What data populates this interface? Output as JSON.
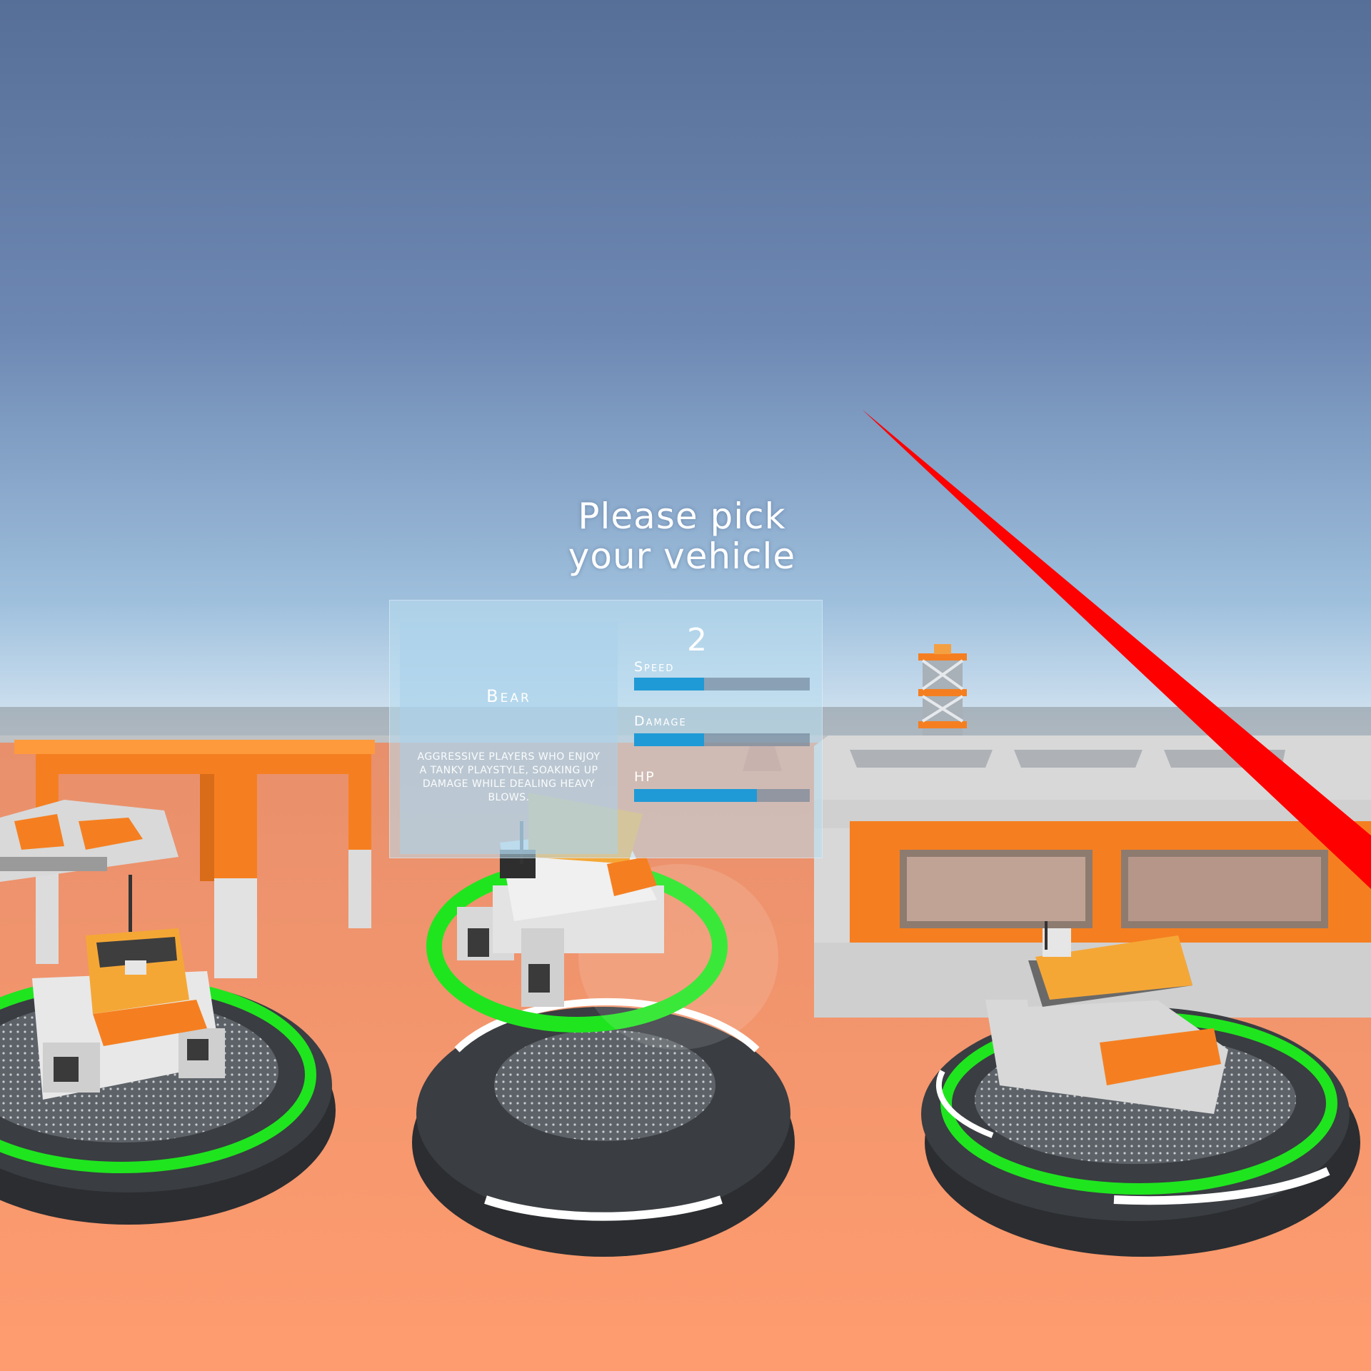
{
  "scene": {
    "sky_top": "#566f98",
    "sky_horizon": "#c9dff0",
    "ground_color": "#f7946a",
    "accent_orange": "#f57f20",
    "ring_green": "#1fe51f",
    "laser_red": "#ff0000"
  },
  "prompt": {
    "line1": "Please pick",
    "line2": "your vehicle"
  },
  "vehicle_panel": {
    "number": "2",
    "name": "Bear",
    "description": "Aggressive players who enjoy a tanky playstyle, soaking up damage while dealing heavy blows.",
    "stats": [
      {
        "label": "Speed",
        "level": 0.4
      },
      {
        "label": "Damage",
        "level": 0.4
      },
      {
        "label": "HP",
        "level": 0.7
      }
    ]
  }
}
